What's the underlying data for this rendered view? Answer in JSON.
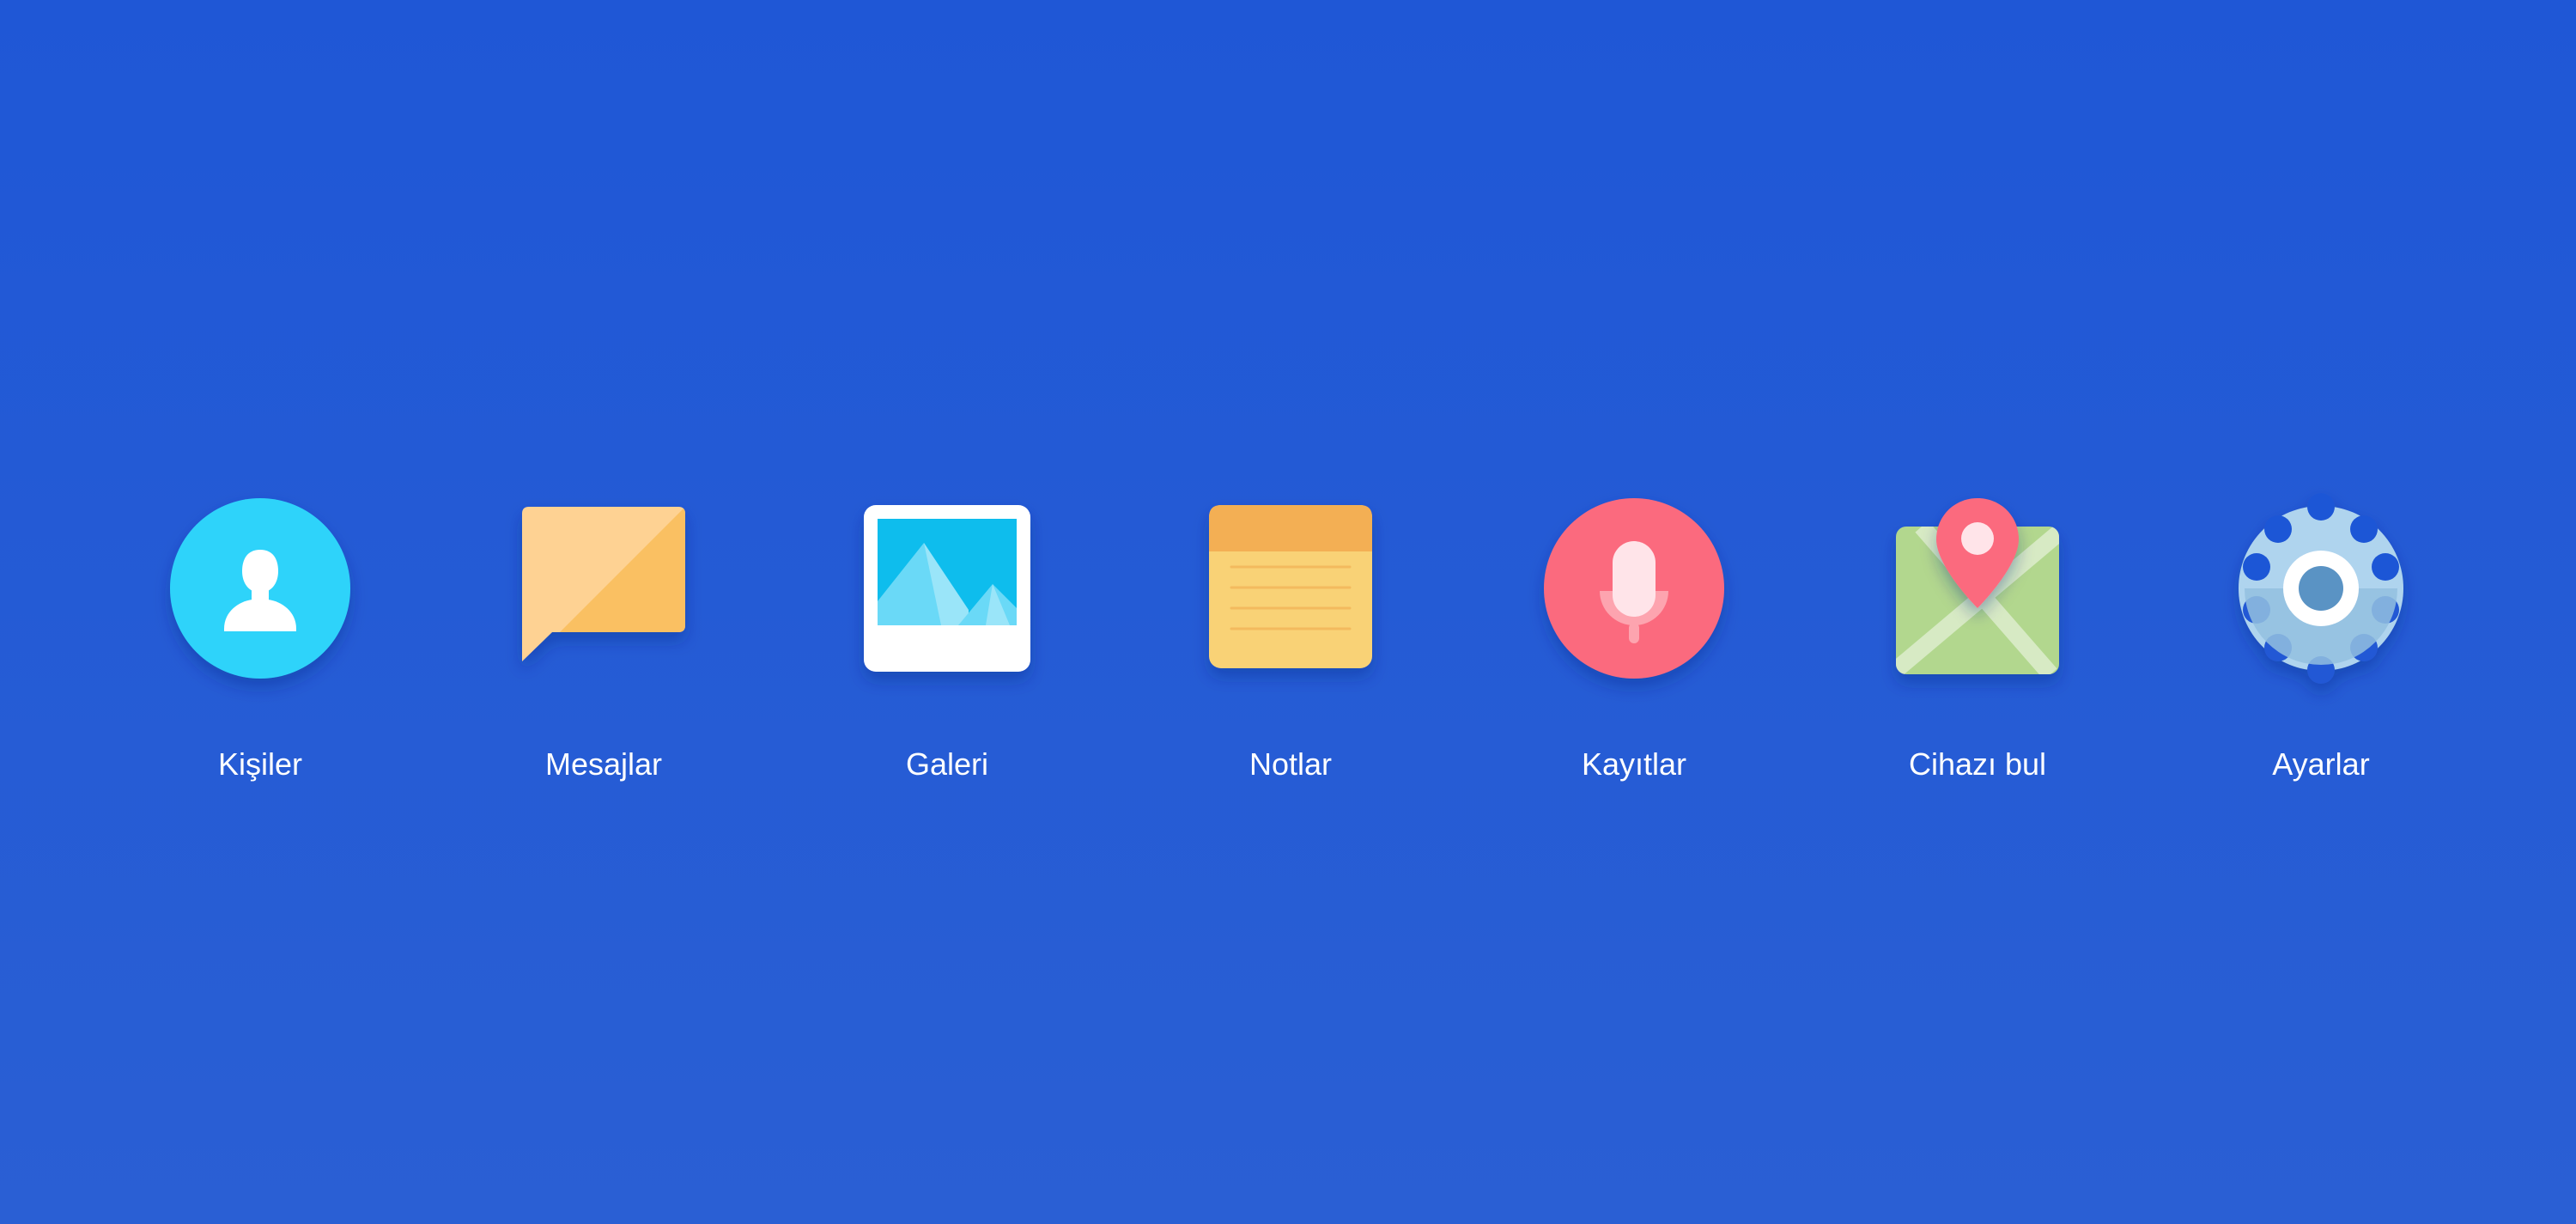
{
  "background_colors": [
    "#1F57D6",
    "#2A5FD4"
  ],
  "apps": [
    {
      "label": "Kişiler",
      "icon": "contacts-icon",
      "color": "#2FD3FA"
    },
    {
      "label": "Mesajlar",
      "icon": "messages-icon",
      "color": "#FAC062"
    },
    {
      "label": "Galeri",
      "icon": "gallery-icon",
      "color": "#0EBDED"
    },
    {
      "label": "Notlar",
      "icon": "notes-icon",
      "color": "#F9D276"
    },
    {
      "label": "Kayıtlar",
      "icon": "recorder-icon",
      "color": "#FB6B7E"
    },
    {
      "label": "Cihazı bul",
      "icon": "find-device-icon",
      "color": "#B2D78E"
    },
    {
      "label": "Ayarlar",
      "icon": "settings-icon",
      "color": "#9EC7E3"
    }
  ]
}
